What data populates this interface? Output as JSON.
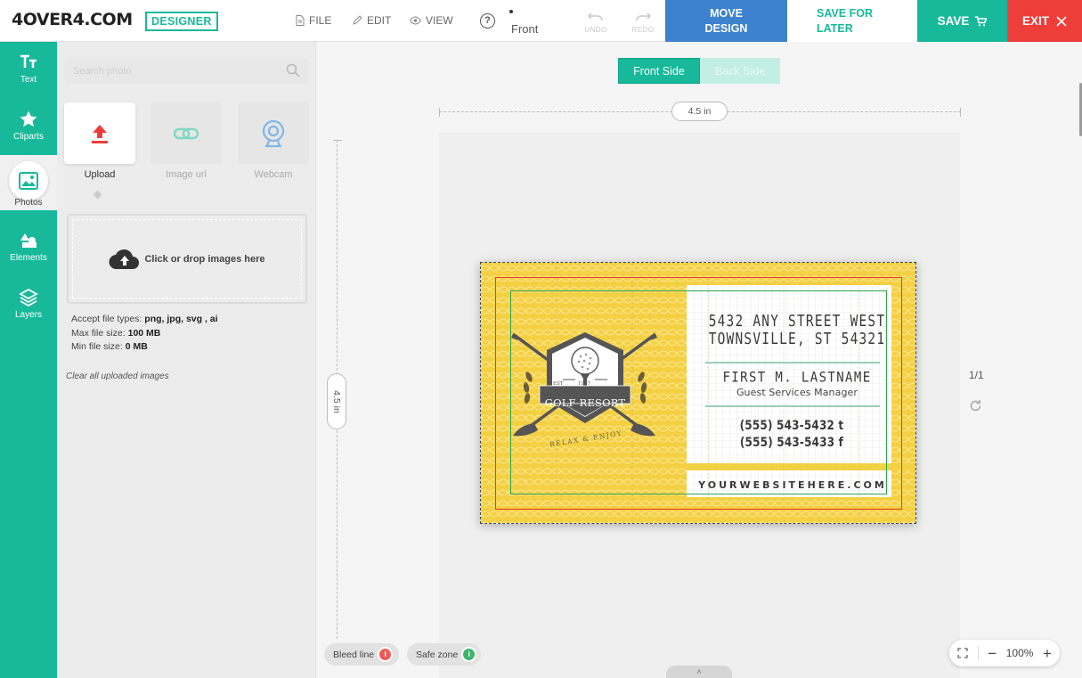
{
  "brand": {
    "logo": "4OVER4.COM",
    "badge": "DESIGNER"
  },
  "menu": {
    "file": "FILE",
    "edit": "EDIT",
    "view": "VIEW",
    "help": "?",
    "current_side": "Front",
    "undo": "UNDO",
    "redo": "REDO"
  },
  "actions": {
    "move_line1": "MOVE",
    "move_line2": "DESIGN",
    "later_line1": "SAVE FOR",
    "later_line2": "LATER",
    "save": "SAVE",
    "exit": "EXIT"
  },
  "rail": [
    {
      "label": "Text",
      "icon": "text-icon"
    },
    {
      "label": "Cliparts",
      "icon": "star-icon"
    },
    {
      "label": "Photos",
      "icon": "photo-icon"
    },
    {
      "label": "Elements",
      "icon": "shapes-icon"
    },
    {
      "label": "Layers",
      "icon": "layers-icon"
    }
  ],
  "panel": {
    "search_placeholder": "Search photo",
    "sources": [
      {
        "label": "Upload",
        "icon": "upload-icon"
      },
      {
        "label": "Image url",
        "icon": "link-icon"
      },
      {
        "label": "Webcam",
        "icon": "webcam-icon"
      }
    ],
    "dropzone": "Click or drop images here",
    "accept_label": "Accept file types: ",
    "accept_value": "png, jpg, svg , ai",
    "max_label": "Max file size: ",
    "max_value": "100 MB",
    "min_label": "Min file size: ",
    "min_value": "0 MB",
    "clear": "Clear all uploaded images"
  },
  "canvas": {
    "tabs": [
      "Front Side",
      "Back Side"
    ],
    "width_label": "4.5 in",
    "height_label": "4.5 in",
    "page_count": "1/1",
    "bleed_chip": "Bleed line",
    "safe_chip": "Safe zone",
    "zoom": "100%"
  },
  "card": {
    "address1": "5432 ANY STREET WEST",
    "address2": "TOWNSVILLE, ST 54321",
    "name": "FIRST M. LASTNAME",
    "title": "Guest Services Manager",
    "phone": "(555) 543-5432 t",
    "fax": "(555) 543-5433 f",
    "website": "YOURWEBSITEHERE.COM",
    "emblem_name": "GOLF RESORT",
    "emblem_est": "EST",
    "emblem_year": "1927",
    "emblem_motto": "RELAX & ENJOY"
  },
  "colors": {
    "accent": "#18b99a",
    "move": "#3d82cf",
    "exit": "#ee3e3a",
    "card_yellow": "#f4d043",
    "bleed": "#e23a2c",
    "safe": "#2aa64f"
  }
}
